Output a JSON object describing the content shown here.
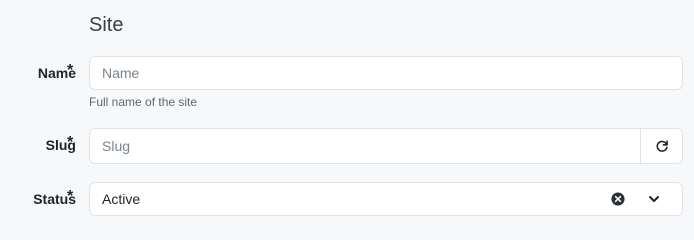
{
  "section": {
    "title": "Site"
  },
  "fields": {
    "name": {
      "label": "Name",
      "required_mark": "*",
      "placeholder": "Name",
      "value": "",
      "help": "Full name of the site"
    },
    "slug": {
      "label": "Slug",
      "required_mark": "*",
      "placeholder": "Slug",
      "value": "",
      "addon_icon": "refresh-icon"
    },
    "status": {
      "label": "Status",
      "required_mark": "*",
      "selected": "Active",
      "clear_icon": "clear-circle-icon",
      "dropdown_icon": "chevron-down-icon"
    }
  }
}
